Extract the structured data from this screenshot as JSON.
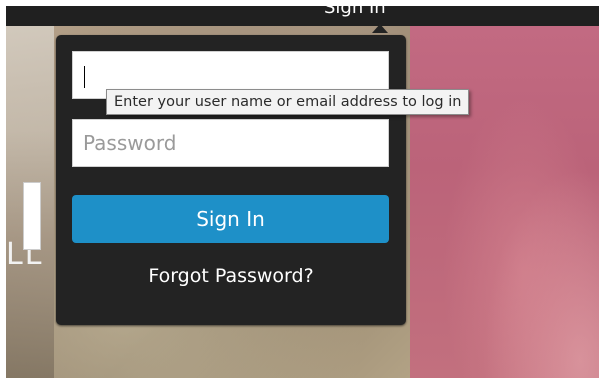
{
  "header": {
    "signin_label": "Sign In"
  },
  "login": {
    "username": {
      "value": "",
      "placeholder": "",
      "tooltip": "Enter your user name or email address to log in"
    },
    "password": {
      "value": "",
      "placeholder": "Password"
    },
    "submit_label": "Sign In",
    "forgot_label": "Forgot Password?"
  },
  "background": {
    "stray_text": "LL"
  },
  "colors": {
    "panel_bg": "#232323",
    "button_bg": "#1e90c8",
    "topbar_bg": "#202020",
    "tooltip_bg": "#f3f3f3"
  }
}
